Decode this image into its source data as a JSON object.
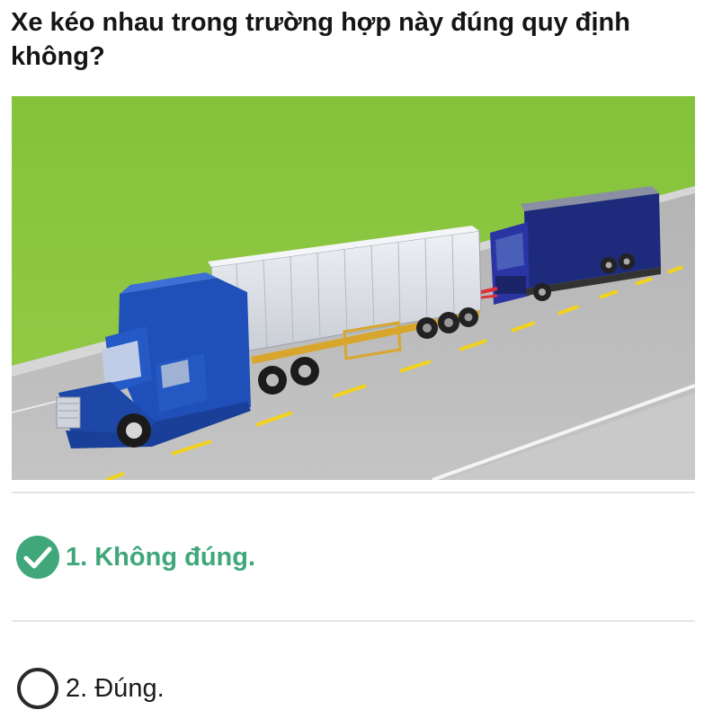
{
  "question": {
    "text": "Xe kéo nhau trong trường hợp này đúng quy định không?"
  },
  "scene": {
    "subject": "towing-scene",
    "colors": {
      "grass": "#8bc53f",
      "road": "#b9b9b9",
      "lane_marking": "#f2d21c",
      "tractor_cab": "#1f4fb8",
      "container": "#dfe3ea",
      "towed_truck": "#252f8c",
      "tow_bar": "#e0303a"
    }
  },
  "answers": [
    {
      "label": "1. Không đúng.",
      "state": "selected-correct",
      "icon": "check-circle-icon"
    },
    {
      "label": "2. Đúng.",
      "state": "unselected",
      "icon": "radio-circle-icon"
    }
  ],
  "theme": {
    "correct": "#3fa77a",
    "divider": "#e4e4e4"
  }
}
